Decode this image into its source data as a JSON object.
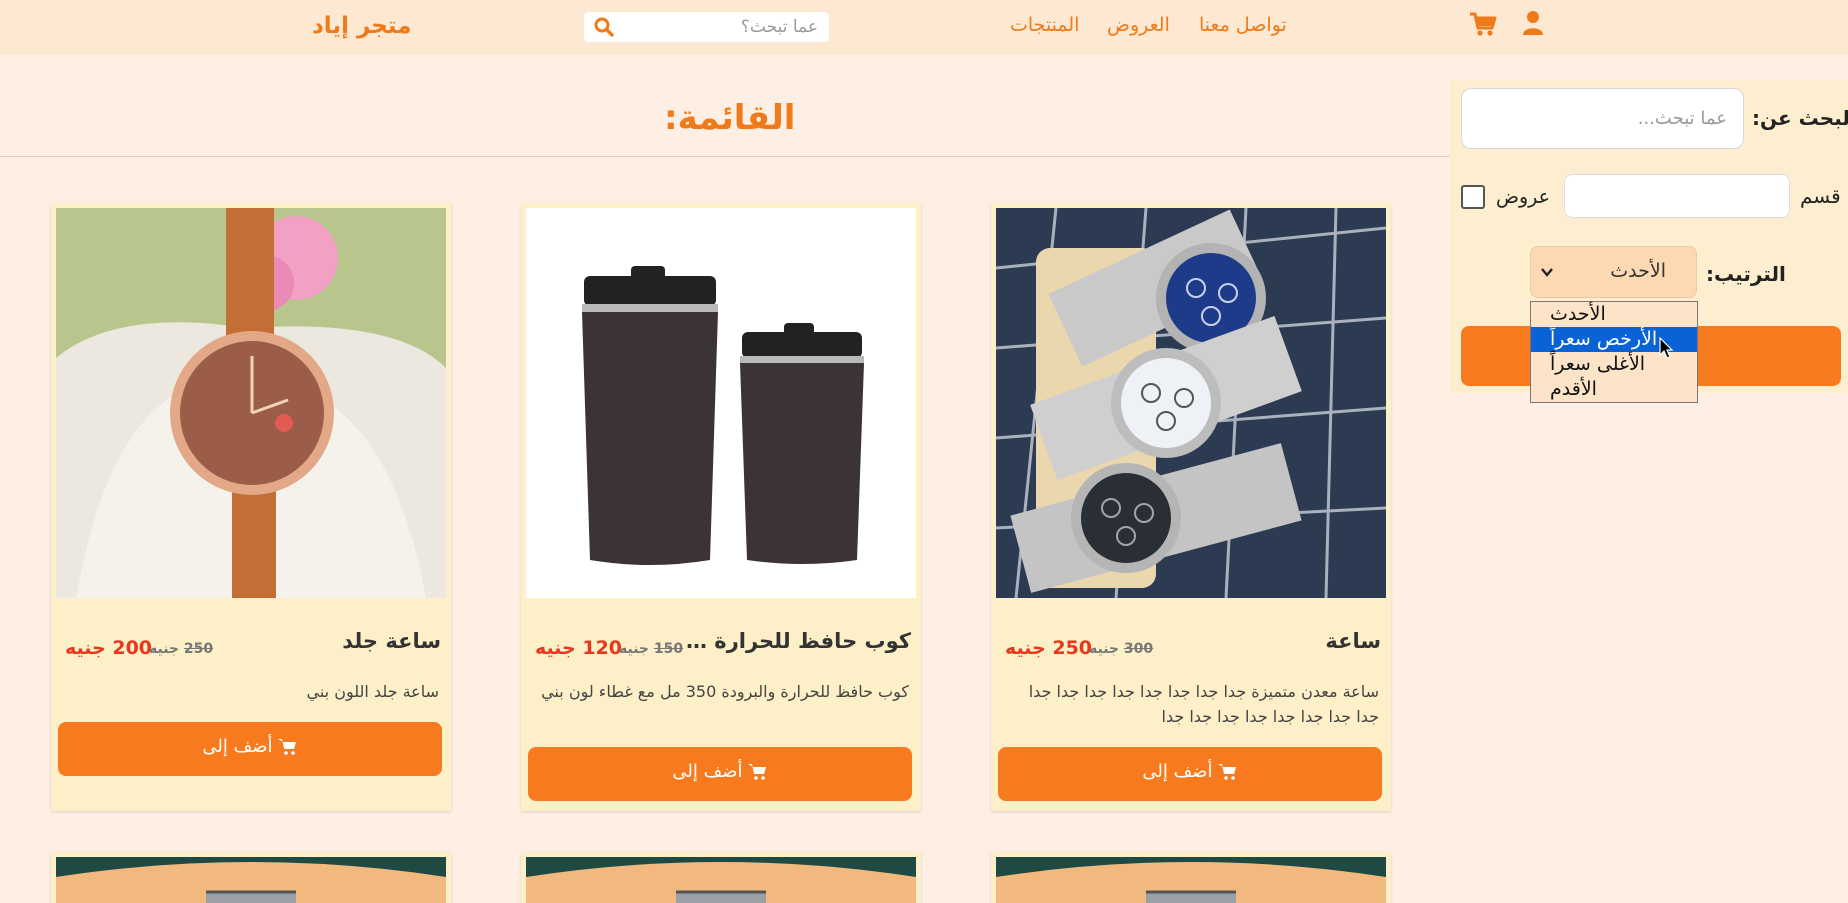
{
  "header": {
    "brand": "متجر إياد",
    "search_placeholder": "عما تبحث؟",
    "nav": {
      "products": "المنتجات",
      "offers": "العروض",
      "contact": "تواصل معنا"
    }
  },
  "main": {
    "title": "القائمة:"
  },
  "sidebar": {
    "search_label": "البحث عن:",
    "search_placeholder": "عما تبحث...",
    "category_label": "قسم",
    "offers_label": "عروض",
    "sort_label": "الترتيب:",
    "sort_selected": "الأحدث",
    "sort_options": [
      "الأحدث",
      "الأرخص سعراً",
      "الأغلى سعراً",
      "الأقدم"
    ],
    "highlighted_option": "الأرخص سعراً"
  },
  "products": [
    {
      "name": "ساعة",
      "price": "250 جنيه",
      "old_price_value": "300",
      "currency": "جنيه",
      "description": "ساعة معدن متميزة جدا جدا جدا جدا جدا جدا جدا جدا جدا جدا جدا جدا جدا جدا جدا جدا",
      "button": "أضف إلى"
    },
    {
      "name": "كوب حافظ للحرارة والبرودة",
      "price": "120 جنيه",
      "old_price_value": "150",
      "currency": "جنيه",
      "description": "كوب حافظ للحرارة والبرودة 350 مل مع غطاء لون بني",
      "button": "أضف إلى"
    },
    {
      "name": "ساعة جلد",
      "price": "200 جنيه",
      "old_price_value": "250",
      "currency": "جنيه",
      "description": "ساعة جلد اللون بني",
      "button": "أضف إلى"
    }
  ],
  "icons": {
    "search": "search-icon",
    "cart": "cart-icon",
    "user": "user-icon",
    "chevron": "chevron-down-icon"
  },
  "colors": {
    "accent": "#f77b1e",
    "price": "#e8371b",
    "card_bg": "#fdf0c8",
    "page_bg": "#fdefe4"
  }
}
